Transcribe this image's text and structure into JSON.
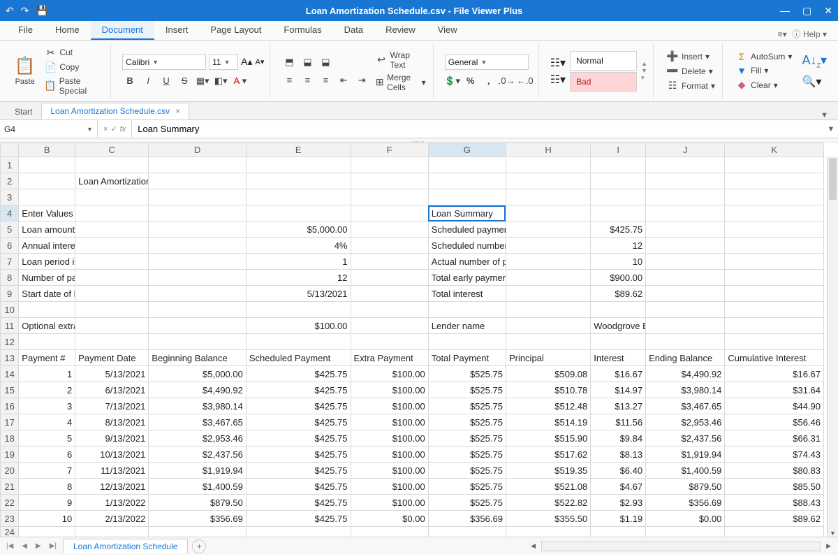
{
  "title": "Loan Amortization Schedule.csv - File Viewer Plus",
  "menu": {
    "tabs": [
      "File",
      "Home",
      "Document",
      "Insert",
      "Page Layout",
      "Formulas",
      "Data",
      "Review",
      "View"
    ],
    "active": 2,
    "help_label": "Help"
  },
  "ribbon": {
    "paste": "Paste",
    "cut": "Cut",
    "copy": "Copy",
    "paste_special": "Paste Special",
    "font_name": "Calibri",
    "font_size": "11",
    "wrap_text": "Wrap Text",
    "merge_cells": "Merge Cells",
    "number_format": "General",
    "style_normal": "Normal",
    "style_bad": "Bad",
    "insert": "Insert",
    "delete": "Delete",
    "format": "Format",
    "autosum": "AutoSum",
    "fill": "Fill",
    "clear": "Clear"
  },
  "file_tabs": {
    "start": "Start",
    "active": "Loan Amortization Schedule.csv"
  },
  "namebox": "G4",
  "formula": "Loan Summary",
  "columns": [
    "B",
    "C",
    "D",
    "E",
    "F",
    "G",
    "H",
    "I",
    "J",
    "K"
  ],
  "active_col": "G",
  "active_row": 4,
  "sheet_tab": "Loan Amortization Schedule",
  "rows": [
    {
      "n": 1,
      "cells": [
        "",
        "",
        "",
        "",
        "",
        "",
        "",
        "",
        "",
        ""
      ]
    },
    {
      "n": 2,
      "cells": [
        "",
        "Loan Amortization Schedule",
        "",
        "",
        "",
        "",
        "",
        "",
        "",
        ""
      ]
    },
    {
      "n": 3,
      "cells": [
        "",
        "",
        "",
        "",
        "",
        "",
        "",
        "",
        "",
        ""
      ]
    },
    {
      "n": 4,
      "cells": [
        "Enter Values",
        "",
        "",
        "",
        "",
        "Loan Summary",
        "",
        "",
        "",
        ""
      ]
    },
    {
      "n": 5,
      "cells": [
        "Loan amount",
        "",
        "",
        "$5,000.00",
        "",
        "Scheduled payment",
        "",
        "$425.75",
        "",
        ""
      ]
    },
    {
      "n": 6,
      "cells": [
        "Annual interest rate",
        "",
        "",
        "4%",
        "",
        "Scheduled number of payments",
        "",
        "12",
        "",
        ""
      ]
    },
    {
      "n": 7,
      "cells": [
        "Loan period in years",
        "",
        "",
        "1",
        "",
        "Actual number of payments",
        "",
        "10",
        "",
        ""
      ]
    },
    {
      "n": 8,
      "cells": [
        "Number of payments per year",
        "",
        "",
        "12",
        "",
        "Total early payments",
        "",
        "$900.00",
        "",
        ""
      ]
    },
    {
      "n": 9,
      "cells": [
        "Start date of loan",
        "",
        "",
        "5/13/2021",
        "",
        "Total interest",
        "",
        "$89.62",
        "",
        ""
      ]
    },
    {
      "n": 10,
      "cells": [
        "",
        "",
        "",
        "",
        "",
        "",
        "",
        "",
        "",
        ""
      ]
    },
    {
      "n": 11,
      "cells": [
        "Optional extra payments",
        "",
        "",
        "$100.00",
        "",
        "Lender name",
        "",
        "Woodgrove Bank",
        "",
        ""
      ]
    },
    {
      "n": 12,
      "cells": [
        "",
        "",
        "",
        "",
        "",
        "",
        "",
        "",
        "",
        ""
      ]
    },
    {
      "n": 13,
      "cells": [
        "Payment #",
        "Payment Date",
        "Beginning Balance",
        "Scheduled Payment",
        "Extra Payment",
        "Total Payment",
        "Principal",
        "Interest",
        "Ending Balance",
        "Cumulative Interest"
      ]
    },
    {
      "n": 14,
      "cells": [
        "1",
        "5/13/2021",
        "$5,000.00",
        "$425.75",
        "$100.00",
        "$525.75",
        "$509.08",
        "$16.67",
        "$4,490.92",
        "$16.67"
      ]
    },
    {
      "n": 15,
      "cells": [
        "2",
        "6/13/2021",
        "$4,490.92",
        "$425.75",
        "$100.00",
        "$525.75",
        "$510.78",
        "$14.97",
        "$3,980.14",
        "$31.64"
      ]
    },
    {
      "n": 16,
      "cells": [
        "3",
        "7/13/2021",
        "$3,980.14",
        "$425.75",
        "$100.00",
        "$525.75",
        "$512.48",
        "$13.27",
        "$3,467.65",
        "$44.90"
      ]
    },
    {
      "n": 17,
      "cells": [
        "4",
        "8/13/2021",
        "$3,467.65",
        "$425.75",
        "$100.00",
        "$525.75",
        "$514.19",
        "$11.56",
        "$2,953.46",
        "$56.46"
      ]
    },
    {
      "n": 18,
      "cells": [
        "5",
        "9/13/2021",
        "$2,953.46",
        "$425.75",
        "$100.00",
        "$525.75",
        "$515.90",
        "$9.84",
        "$2,437.56",
        "$66.31"
      ]
    },
    {
      "n": 19,
      "cells": [
        "6",
        "10/13/2021",
        "$2,437.56",
        "$425.75",
        "$100.00",
        "$525.75",
        "$517.62",
        "$8.13",
        "$1,919.94",
        "$74.43"
      ]
    },
    {
      "n": 20,
      "cells": [
        "7",
        "11/13/2021",
        "$1,919.94",
        "$425.75",
        "$100.00",
        "$525.75",
        "$519.35",
        "$6.40",
        "$1,400.59",
        "$80.83"
      ]
    },
    {
      "n": 21,
      "cells": [
        "8",
        "12/13/2021",
        "$1,400.59",
        "$425.75",
        "$100.00",
        "$525.75",
        "$521.08",
        "$4.67",
        "$879.50",
        "$85.50"
      ]
    },
    {
      "n": 22,
      "cells": [
        "9",
        "1/13/2022",
        "$879.50",
        "$425.75",
        "$100.00",
        "$525.75",
        "$522.82",
        "$2.93",
        "$356.69",
        "$88.43"
      ]
    },
    {
      "n": 23,
      "cells": [
        "10",
        "2/13/2022",
        "$356.69",
        "$425.75",
        "$0.00",
        "$356.69",
        "$355.50",
        "$1.19",
        "$0.00",
        "$89.62"
      ]
    }
  ],
  "right_align_from_row": 14,
  "right_align_col_e_rows": [
    5,
    6,
    7,
    8,
    9,
    11
  ],
  "right_align_col_i_rows": [
    5,
    6,
    7,
    8,
    9
  ]
}
